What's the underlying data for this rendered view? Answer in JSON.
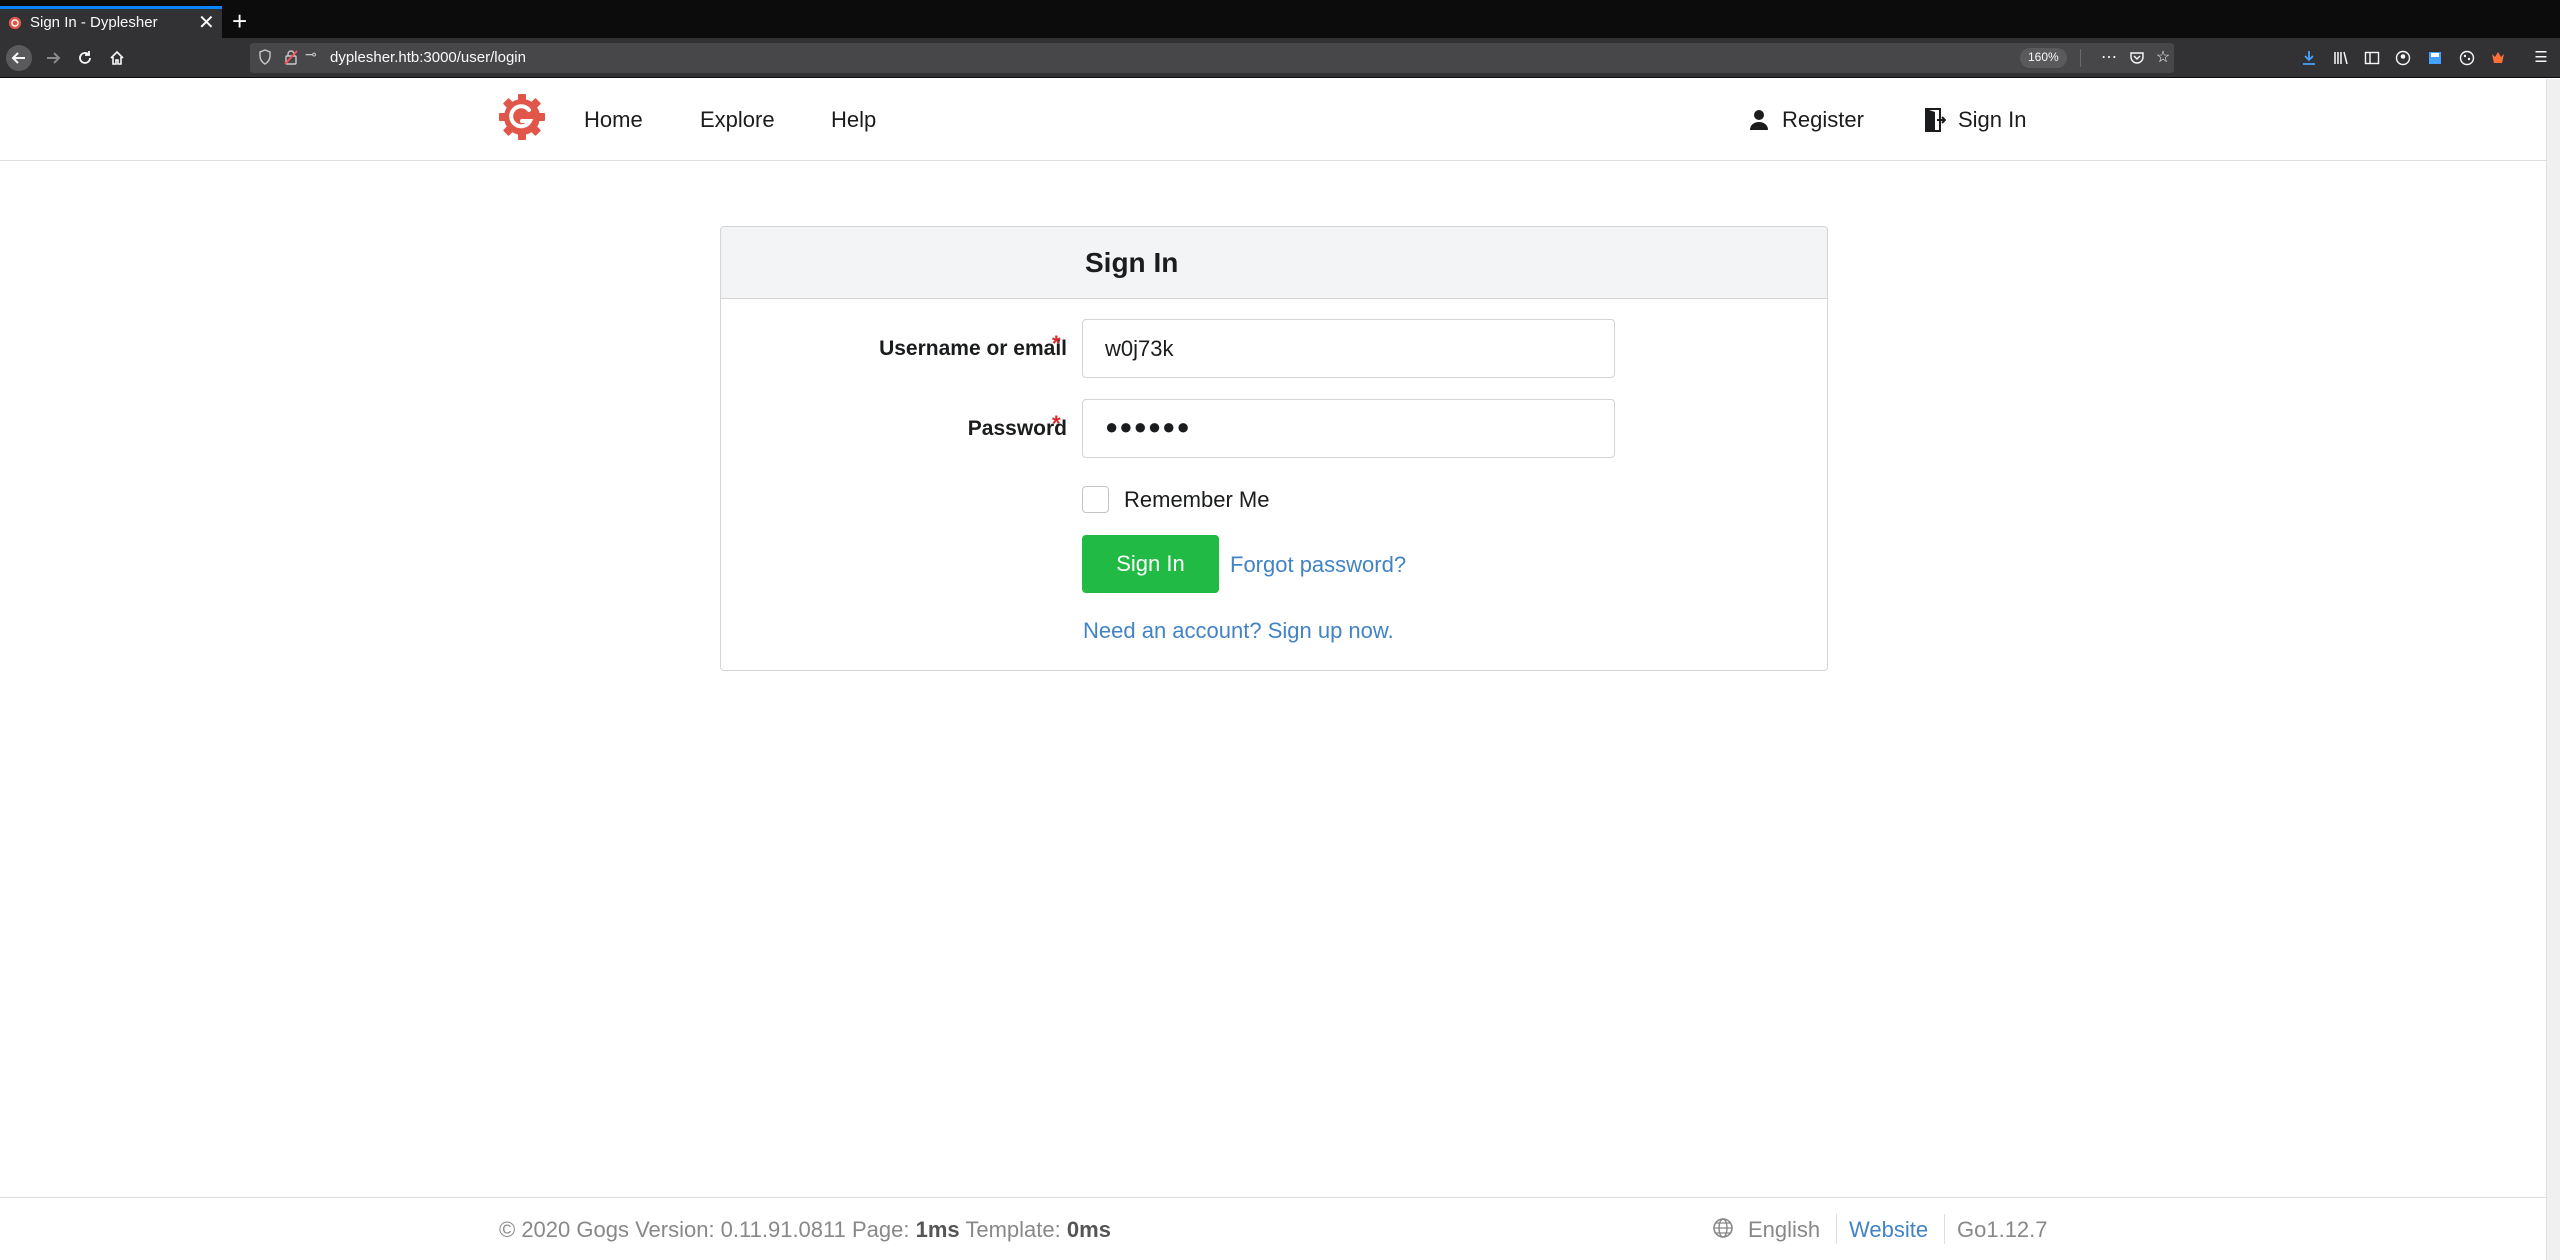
{
  "browser": {
    "tab_title": "Sign In - Dyplesher",
    "tab_close": "✕",
    "new_tab": "+",
    "url": "dyplesher.htb:3000/user/login",
    "zoom": "160%"
  },
  "header": {
    "nav": {
      "home": "Home",
      "explore": "Explore",
      "help": "Help"
    },
    "register": "Register",
    "signin": "Sign In"
  },
  "form": {
    "title": "Sign In",
    "username_label": "Username or email",
    "username_value": "w0j73k",
    "password_label": "Password",
    "password_masked": "●●●●●●",
    "required_marker": "*",
    "remember_label": "Remember Me",
    "remember_checked": false,
    "submit_label": "Sign In",
    "forgot_label": "Forgot password?",
    "signup_label": "Need an account? Sign up now."
  },
  "footer": {
    "copyright": "© 2020 Gogs Version: 0.11.91.0811 Page:",
    "page_time": "1ms",
    "template_label": "Template:",
    "template_time": "0ms",
    "language": "English",
    "website": "Website",
    "go_version": "Go1.12.7"
  },
  "colors": {
    "brand": "#e0574a",
    "primary_button": "#21ba45",
    "link": "#4183c4",
    "required": "#db2828"
  }
}
